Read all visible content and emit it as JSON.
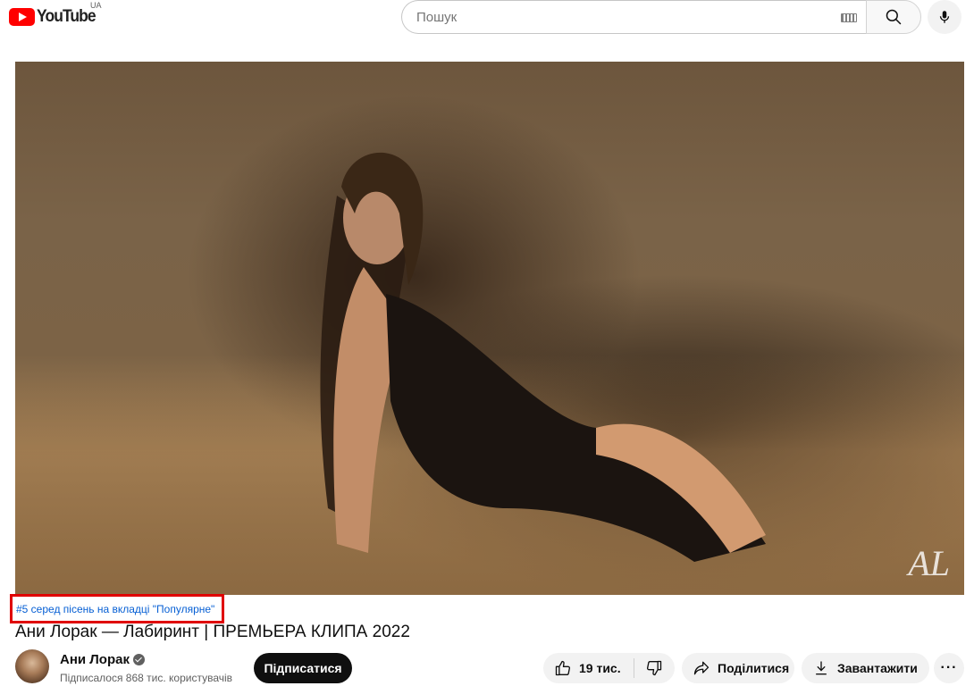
{
  "header": {
    "logo_text": "YouTube",
    "country_code": "UA",
    "search_placeholder": "Пошук"
  },
  "icons": [
    "youtube-logo-icon",
    "keyboard-icon",
    "search-icon",
    "microphone-icon",
    "verified-icon",
    "thumbs-up-icon",
    "thumbs-down-icon",
    "share-icon",
    "download-icon",
    "more-icon"
  ],
  "player": {
    "watermark": "AL"
  },
  "video": {
    "ranking_badge": "#5 серед пісень на вкладці \"Популярне\"",
    "title": "Ани Лорак — Лабиринт | ПРЕМЬЕРА КЛИПА 2022"
  },
  "channel": {
    "name": "Ани Лорак",
    "subscribers": "Підписалося 868 тис. користувачів",
    "subscribe_label": "Підписатися"
  },
  "actions": {
    "likes": "19 тис.",
    "share_label": "Поділитися",
    "download_label": "Завантажити",
    "more_label": "···"
  },
  "colors": {
    "brand_red": "#ff0000",
    "link_blue": "#065fd4",
    "highlight_border": "#e00000"
  }
}
